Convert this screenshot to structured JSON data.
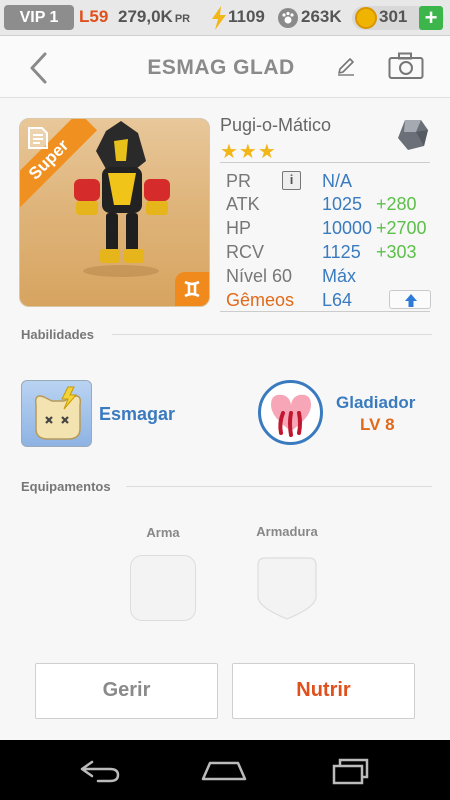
{
  "topbar": {
    "vip": "VIP 1",
    "level": "L59",
    "power": "279,0K",
    "power_unit": "PR",
    "energy": "1109",
    "paws": "263K",
    "coins": "301",
    "add_label": "+"
  },
  "header": {
    "title": "ESMAG GLAD",
    "back_icon": "chevron-left-icon",
    "edit_icon": "pencil-icon",
    "camera_icon": "camera-icon"
  },
  "monster": {
    "badge": "Super",
    "name": "Pugi-o-Mático",
    "stars": "★★★",
    "stats": {
      "pr_label": "PR",
      "pr_value": "N/A",
      "atk_label": "ATK",
      "atk_value": "1025",
      "atk_bonus": "+280",
      "hp_label": "HP",
      "hp_value": "10000",
      "hp_bonus": "+2700",
      "rcv_label": "RCV",
      "rcv_value": "1125",
      "rcv_bonus": "+303",
      "level_label": "Nível 60",
      "level_value": "Máx",
      "gem_label": "Gêmeos",
      "gem_value": "L64"
    }
  },
  "abilities": {
    "section_label": "Habilidades",
    "skill1_name": "Esmagar",
    "skill2_name": "Gladiador",
    "skill2_level": "LV 8"
  },
  "equipment": {
    "section_label": "Equipamentos",
    "weapon_label": "Arma",
    "armor_label": "Armadura"
  },
  "actions": {
    "manage_label": "Gerir",
    "feed_label": "Nutrir"
  },
  "colors": {
    "accent_orange": "#e0501d",
    "stat_blue": "#3a7bbf",
    "bonus_green": "#5cbf4a",
    "add_green": "#3cb54a"
  }
}
